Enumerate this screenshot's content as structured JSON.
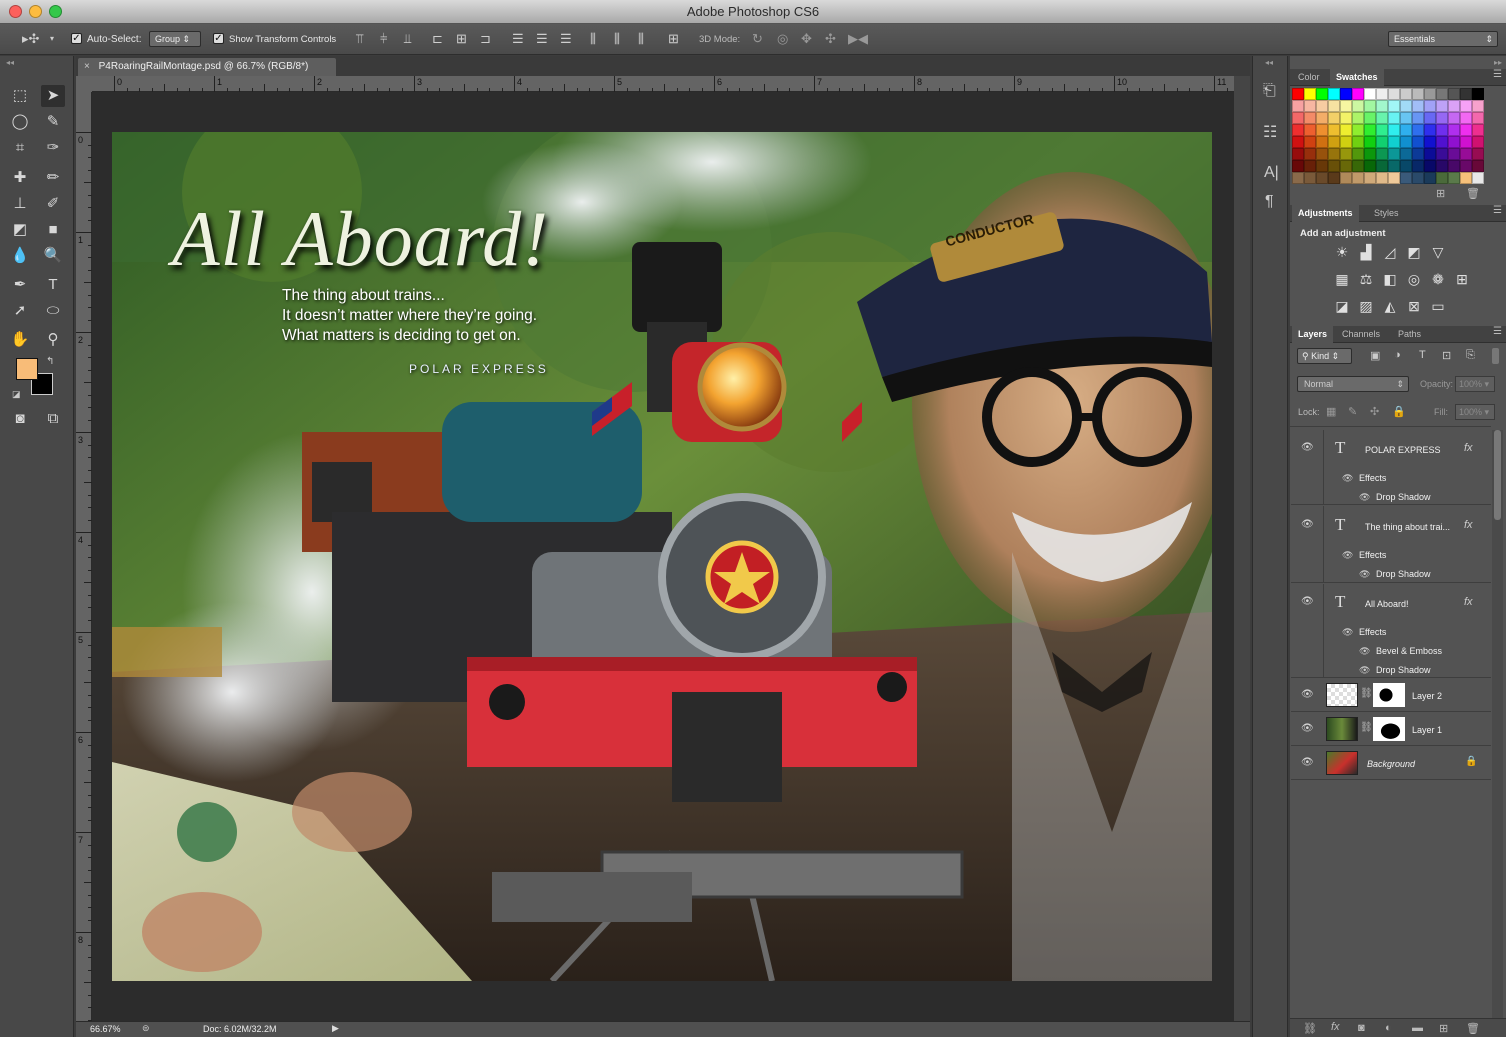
{
  "app": {
    "title": "Adobe Photoshop CS6"
  },
  "options_bar": {
    "auto_select_label": "Auto-Select:",
    "auto_select_checked": true,
    "auto_select_target": "Group",
    "show_transform_label": "Show Transform Controls",
    "show_transform_checked": true,
    "mode_3d_label": "3D Mode:",
    "workspace": "Essentials"
  },
  "document": {
    "tab_title": "P4RoaringRailMontage.psd @ 66.7% (RGB/8*)",
    "ruler_h": [
      "0",
      "1",
      "2",
      "3",
      "4",
      "5",
      "6",
      "7",
      "8",
      "9",
      "10",
      "11"
    ],
    "ruler_v": [
      "0",
      "1",
      "2",
      "3",
      "4",
      "5",
      "6",
      "7",
      "8"
    ],
    "zoom": "66.67%",
    "doc_size": "Doc: 6.02M/32.2M"
  },
  "artwork": {
    "headline": "All Aboard!",
    "quote_line1": "The thing about trains...",
    "quote_line2": "It doesn’t matter where they’re going.",
    "quote_line3": "What matters is deciding to get on.",
    "film_title": "POLAR EXPRESS",
    "cap_badge": "CONDUCTOR"
  },
  "toolbox": {
    "foreground_color": "#f8bc78",
    "background_color": "#000000"
  },
  "color_panel": {
    "tabs": [
      "Color",
      "Swatches"
    ],
    "active_tab": "Swatches"
  },
  "adjustments_panel": {
    "tabs": [
      "Adjustments",
      "Styles"
    ],
    "active_tab": "Adjustments",
    "heading": "Add an adjustment"
  },
  "layers_panel": {
    "tabs": [
      "Layers",
      "Channels",
      "Paths"
    ],
    "active_tab": "Layers",
    "filter_kind": "Kind",
    "blend_mode": "Normal",
    "opacity_label": "Opacity:",
    "opacity_value": "100%",
    "lock_label": "Lock:",
    "fill_label": "Fill:",
    "fill_value": "100%",
    "layers": [
      {
        "name": "POLAR EXPRESS",
        "type": "text",
        "effects_label": "Effects",
        "effects": [
          "Drop Shadow"
        ]
      },
      {
        "name": "The thing about trai...",
        "type": "text",
        "effects_label": "Effects",
        "effects": [
          "Drop Shadow"
        ]
      },
      {
        "name": "All Aboard!",
        "type": "text",
        "effects_label": "Effects",
        "effects": [
          "Bevel & Emboss",
          "Drop Shadow"
        ]
      },
      {
        "name": "Layer 2",
        "type": "masked"
      },
      {
        "name": "Layer 1",
        "type": "masked"
      },
      {
        "name": "Background",
        "type": "background",
        "locked": true
      }
    ],
    "fx_glyph": "fx"
  },
  "colors": {
    "panel_bg": "#535353",
    "dark_bg": "#3c3c3c",
    "canvas_red": "#d8303a"
  }
}
